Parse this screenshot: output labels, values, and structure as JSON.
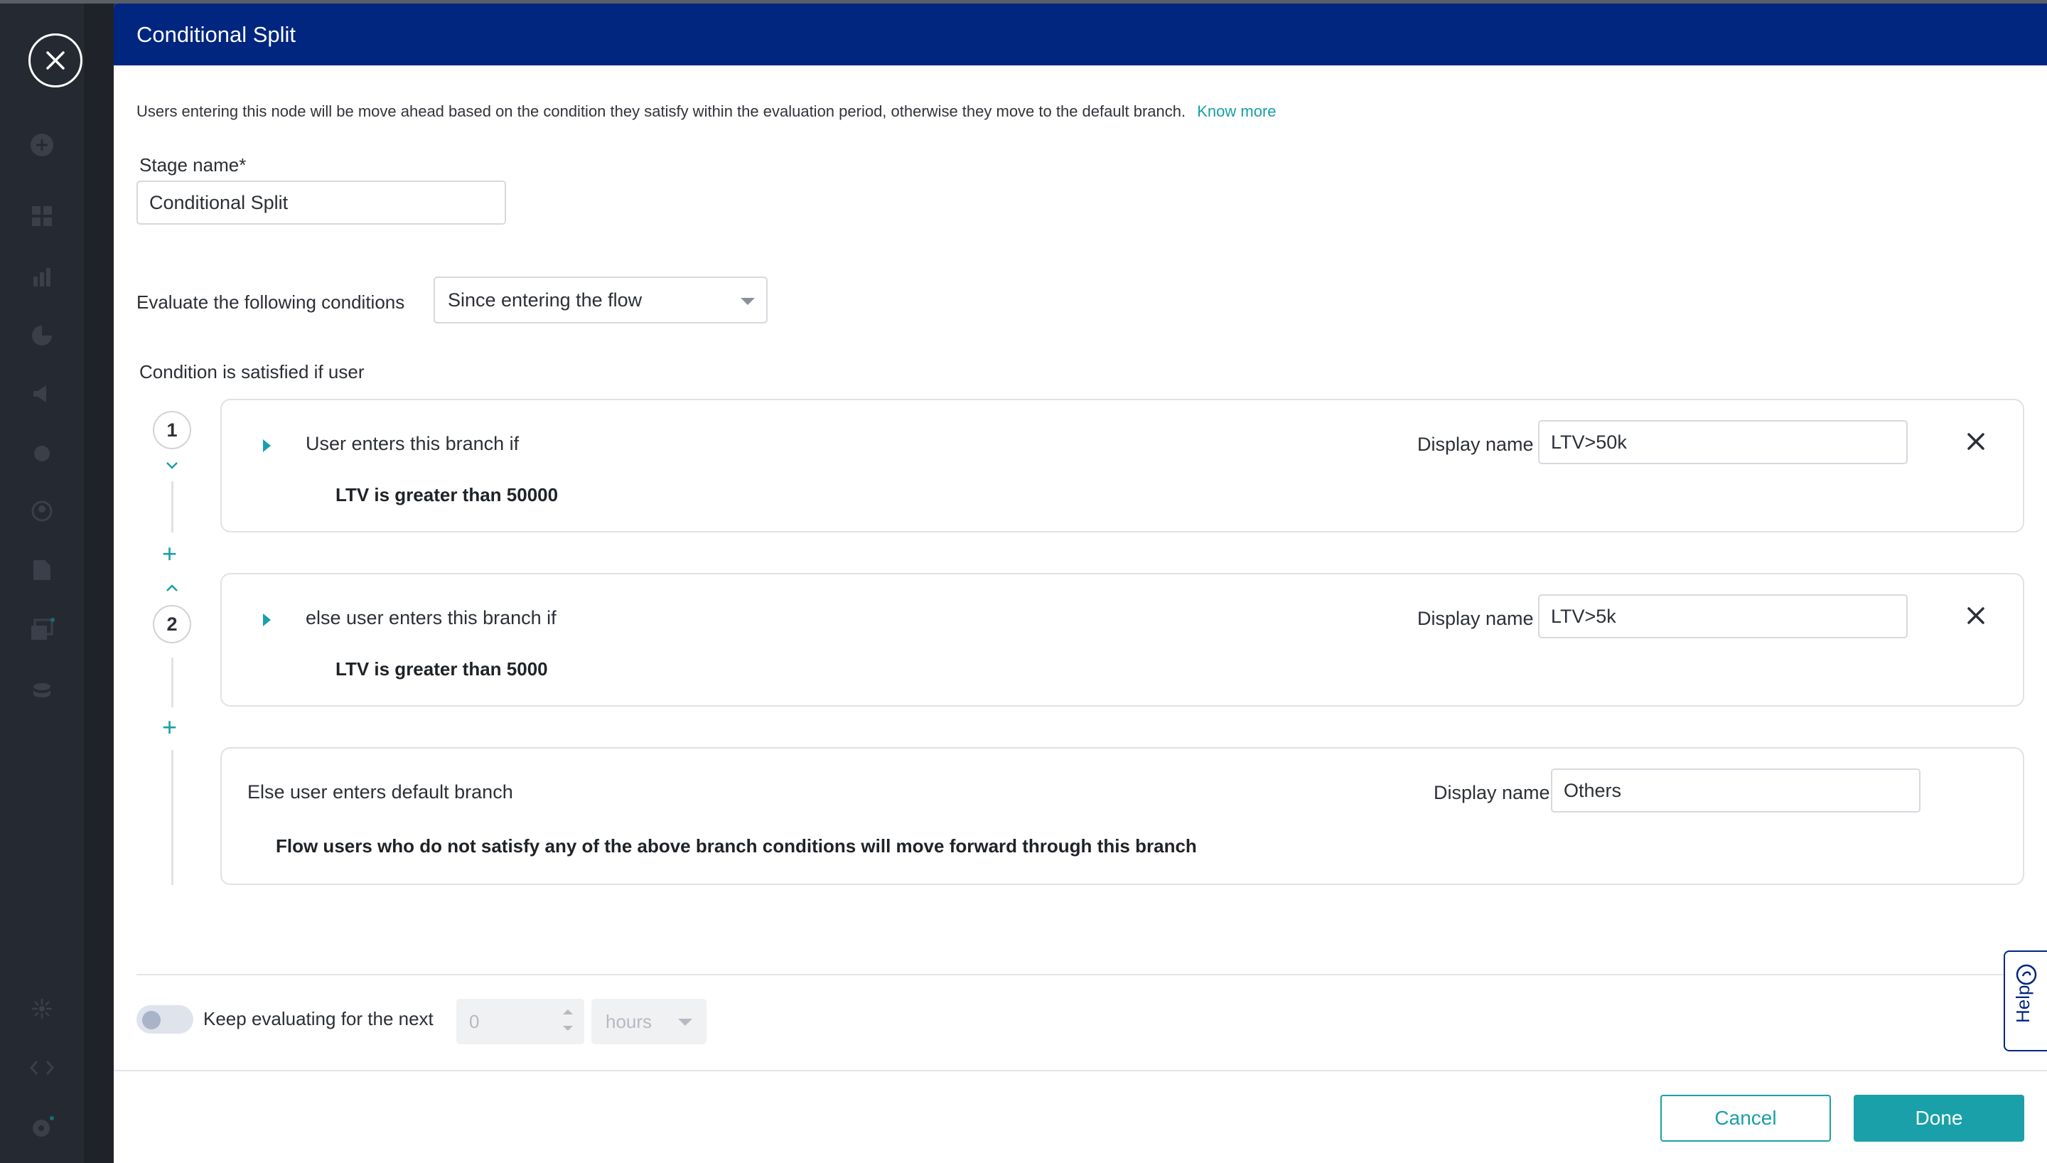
{
  "modal": {
    "title": "Conditional Split",
    "intro_text": "Users entering this node will be move ahead based on the condition they satisfy within the evaluation period, otherwise they move to the default branch.",
    "know_more_link": "Know more"
  },
  "stage": {
    "label": "Stage name*",
    "value": "Conditional Split"
  },
  "evaluate": {
    "label": "Evaluate the following conditions",
    "selected": "Since entering the flow"
  },
  "condition_heading": "Condition is satisfied if user",
  "branches": [
    {
      "number": "1",
      "title": "User enters this branch if",
      "condition": "LTV is greater than 50000",
      "display_name_label": "Display name",
      "display_name": "LTV>50k"
    },
    {
      "number": "2",
      "title": "else user enters this branch if",
      "condition": "LTV is greater than 5000",
      "display_name_label": "Display name",
      "display_name": "LTV>5k"
    }
  ],
  "default_branch": {
    "title": "Else user enters default branch",
    "description": "Flow users who do not satisfy any of the above branch conditions will move forward through this branch",
    "display_name_label": "Display name",
    "display_name": "Others"
  },
  "keep_evaluating": {
    "label": "Keep evaluating for the next",
    "enabled": false,
    "value_placeholder": "0",
    "unit": "hours"
  },
  "footer": {
    "cancel_label": "Cancel",
    "done_label": "Done"
  },
  "help_tab": {
    "label": "Help"
  },
  "colors": {
    "header_bg": "#002680",
    "accent": "#1aa0a8",
    "sidebar_bg": "#252931"
  },
  "icons": {
    "close": "close-icon",
    "expand": "caret-right-icon",
    "remove": "x-icon",
    "add": "plus-icon",
    "help": "help-circle-icon"
  }
}
